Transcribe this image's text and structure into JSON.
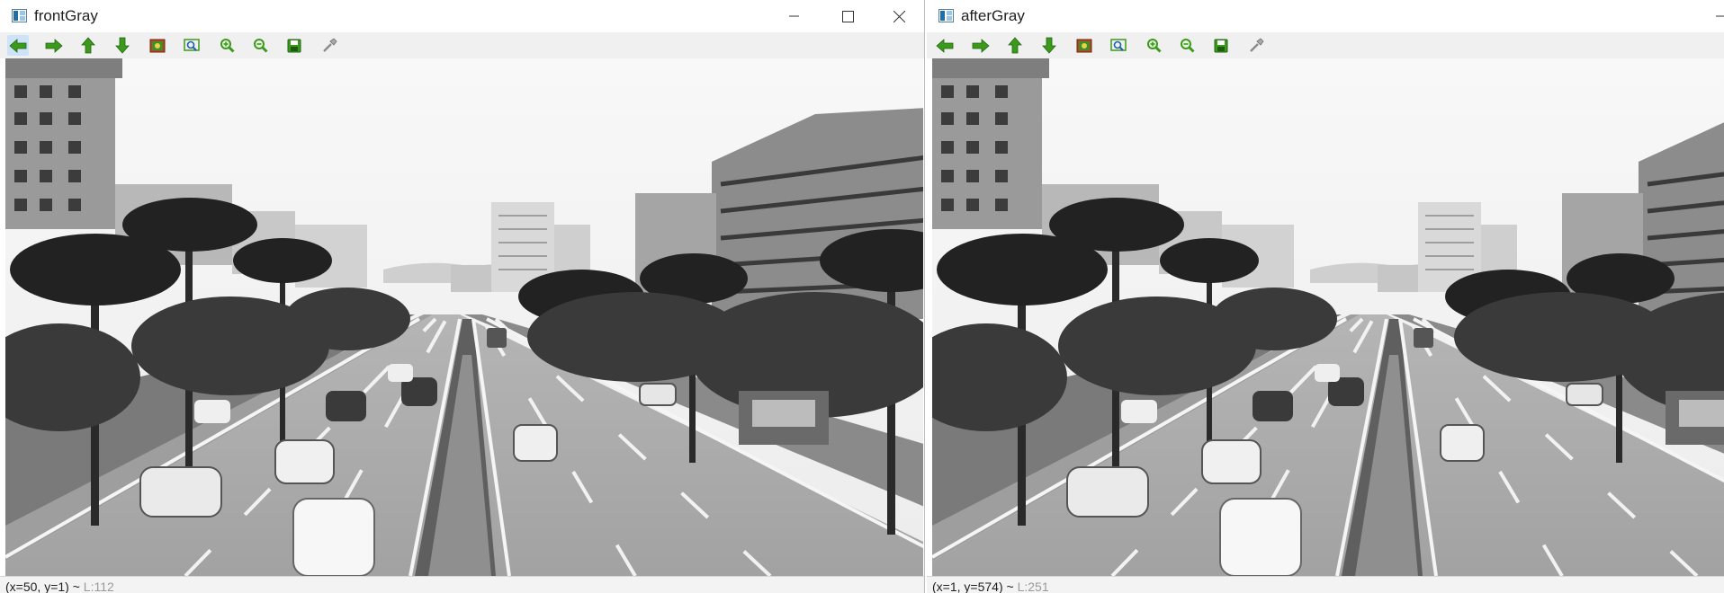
{
  "windows": [
    {
      "title": "frontGray",
      "status": {
        "coords": "(x=50, y=1)",
        "separator": "~",
        "value": "L:112"
      },
      "has_caption_buttons": true
    },
    {
      "title": "afterGray",
      "status": {
        "coords": "(x=1, y=574)",
        "separator": "~",
        "value": "L:251"
      },
      "has_caption_buttons": false
    }
  ],
  "toolbar_tools": [
    {
      "icon": "pan-left-icon",
      "tooltip": "Panning left"
    },
    {
      "icon": "pan-right-icon",
      "tooltip": "Panning right"
    },
    {
      "icon": "pan-up-icon",
      "tooltip": "Panning up"
    },
    {
      "icon": "pan-down-icon",
      "tooltip": "Panning down"
    },
    {
      "icon": "zoom-original-icon",
      "tooltip": "Zoom x1"
    },
    {
      "icon": "zoom-fit-icon",
      "tooltip": "Zoom adjusted"
    },
    {
      "icon": "zoom-in-icon",
      "tooltip": "Zoom in"
    },
    {
      "icon": "zoom-out-icon",
      "tooltip": "Zoom out"
    },
    {
      "icon": "save-icon",
      "tooltip": "Save current image"
    },
    {
      "icon": "properties-icon",
      "tooltip": "Display properties window"
    }
  ],
  "colors": {
    "toolbar_green": "#3b9a1b",
    "toolbar_bg": "#f0f0f0",
    "active_tool_bg": "#cde3f7"
  }
}
